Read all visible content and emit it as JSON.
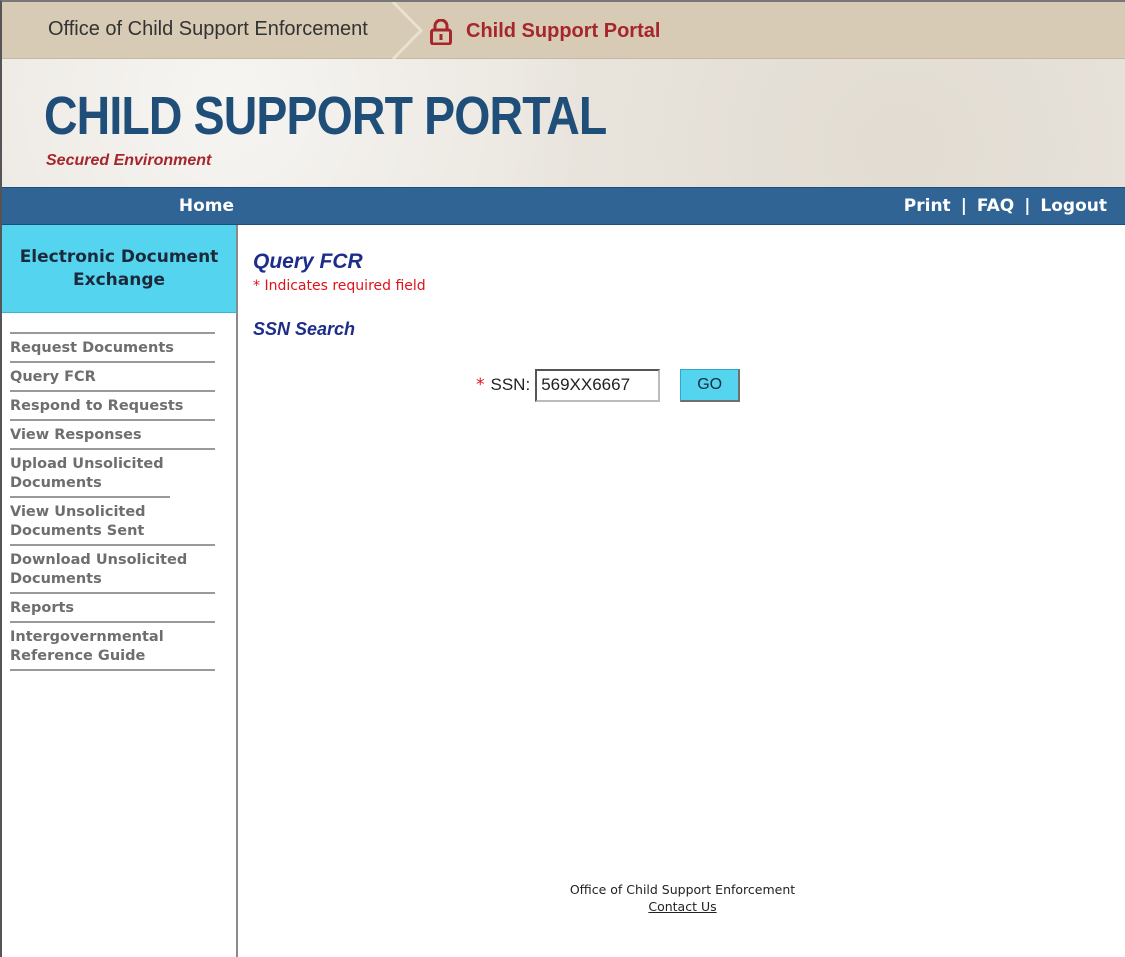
{
  "topbar": {
    "agency": "Office of Child Support Enforcement",
    "portal_link": "Child Support Portal",
    "lock_icon": "lock-icon",
    "colors": {
      "background": "#d7cbb5",
      "portal_link": "#a5262b"
    }
  },
  "banner": {
    "title": "CHILD SUPPORT PORTAL",
    "subtitle": "Secured Environment",
    "colors": {
      "title": "#1f4e79",
      "subtitle": "#a5262b"
    }
  },
  "navbar": {
    "home": "Home",
    "print": "Print",
    "faq": "FAQ",
    "logout": "Logout",
    "separator": "|",
    "colors": {
      "background": "#2f6494",
      "text": "#ffffff"
    }
  },
  "sidebar": {
    "header": "Electronic Document Exchange",
    "items": [
      {
        "label": "Request Documents"
      },
      {
        "label": "Query FCR"
      },
      {
        "label": "Respond to Requests"
      },
      {
        "label": "View Responses"
      },
      {
        "label": "Upload Unsolicited Documents"
      },
      {
        "label": "View Unsolicited Documents Sent"
      },
      {
        "label": "Download Unsolicited Documents"
      },
      {
        "label": "Reports"
      },
      {
        "label": "Intergovernmental Reference Guide"
      }
    ],
    "colors": {
      "header_background": "#55d4f0"
    }
  },
  "main": {
    "title": "Query FCR",
    "required_note": "* Indicates required field",
    "section_title": "SSN Search",
    "ssn": {
      "required_marker": "*",
      "label": "SSN:",
      "value": "569XX6667"
    },
    "go_button": "GO",
    "colors": {
      "title": "#1c2d8a",
      "required": "#e0121a",
      "button": "#55d4f0"
    }
  },
  "footer": {
    "org": "Office of Child Support Enforcement",
    "contact": "Contact Us"
  }
}
